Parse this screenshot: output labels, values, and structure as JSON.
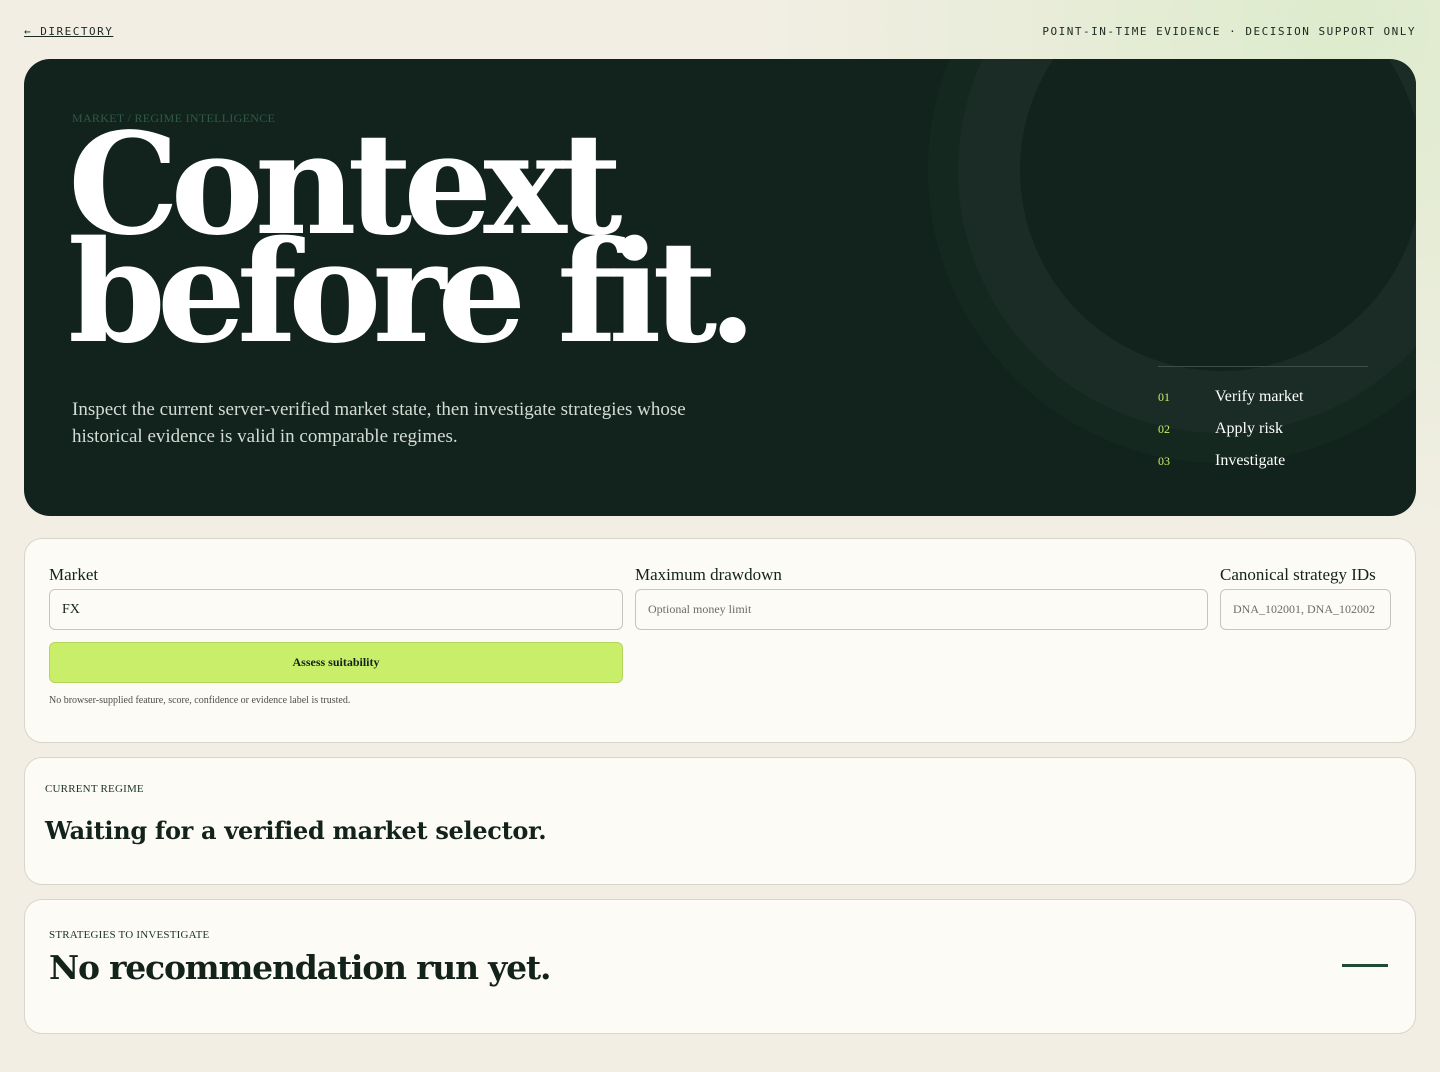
{
  "topbar": {
    "back_label": "← DIRECTORY",
    "tagline": "POINT-IN-TIME EVIDENCE · DECISION SUPPORT ONLY"
  },
  "hero": {
    "eyebrow": "MARKET / REGIME INTELLIGENCE",
    "title_line1": "Context",
    "title_line2": "before fit.",
    "subtitle": "Inspect the current server-verified market state, then investigate strategies whose historical evidence is valid in comparable regimes.",
    "steps": [
      {
        "num": "01",
        "label": "Verify market"
      },
      {
        "num": "02",
        "label": "Apply risk"
      },
      {
        "num": "03",
        "label": "Investigate"
      }
    ]
  },
  "form": {
    "market": {
      "label": "Market",
      "value": "FX"
    },
    "drawdown": {
      "label": "Maximum drawdown",
      "placeholder": "Optional money limit"
    },
    "strategy_ids": {
      "label": "Canonical strategy IDs",
      "placeholder": "DNA_102001, DNA_102002"
    },
    "assess_label": "Assess suitability",
    "note": "No browser-supplied feature, score, confidence or evidence label is trusted."
  },
  "regime": {
    "eyebrow": "CURRENT REGIME",
    "title": "Waiting for a verified market selector."
  },
  "strategies": {
    "eyebrow": "STRATEGIES TO INVESTIGATE",
    "title": "No recommendation run yet."
  },
  "colors": {
    "page_bg": "#f2eee4",
    "hero_bg": "#12231d",
    "accent_lime": "#c9ef6a",
    "card_bg": "#fcfbf6",
    "ink": "#13231c"
  }
}
